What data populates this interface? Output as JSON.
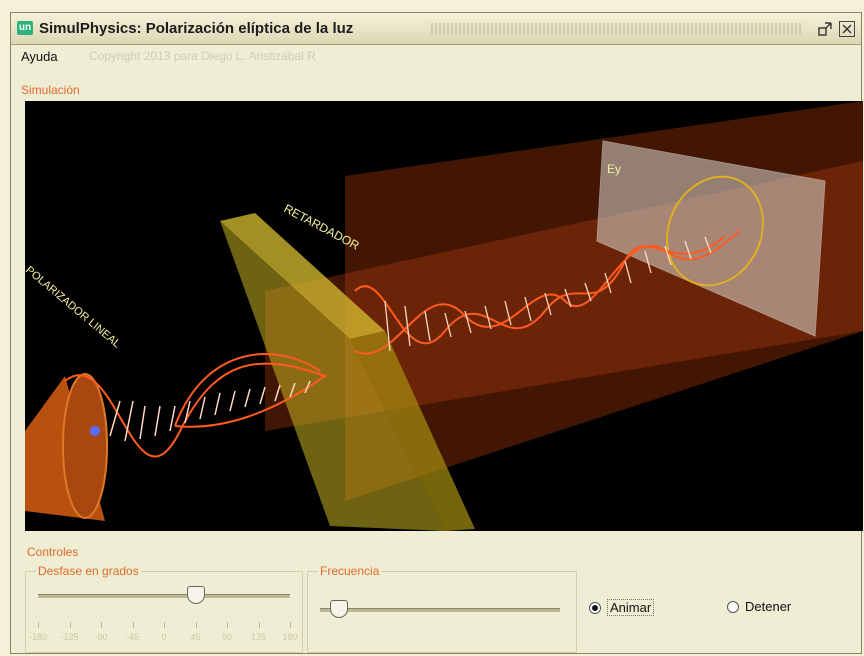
{
  "window": {
    "title": "SimulPhysics: Polarización elíptica de la luz",
    "app_icon_text": "un",
    "minimize_icon": "restore-icon",
    "close_icon": "close-icon"
  },
  "menu": {
    "items": [
      "Ayuda"
    ],
    "copyright": "Copyright 2013 para Diego L. Aristizábal R"
  },
  "simulation": {
    "group_label": "Simulación",
    "labels": {
      "polarizer": "POLARIZADOR LINEAL",
      "retarder": "RETARDADOR",
      "ey": "Ey"
    },
    "colors": {
      "background": "#000000",
      "wave": "#ff5a1f",
      "wave_hatch": "#ffd8c0",
      "retarder": "#c8b420",
      "beam": "#b8400e",
      "screen": "#d9d6cf",
      "ellipse": "#e0b020",
      "labels": "#f0f0a0"
    }
  },
  "controls": {
    "group_label": "Controles",
    "phase": {
      "label": "Desfase en grados",
      "value": 45,
      "min": -180,
      "max": 180,
      "tick_labels": [
        "-180",
        "-135",
        "-90",
        "-45",
        "0",
        "45",
        "90",
        "135",
        "180"
      ]
    },
    "frequency": {
      "label": "Frecuencia",
      "value": 0.08
    },
    "radios": [
      {
        "label": "Animar",
        "checked": true
      },
      {
        "label": "Detener",
        "checked": false
      }
    ]
  }
}
